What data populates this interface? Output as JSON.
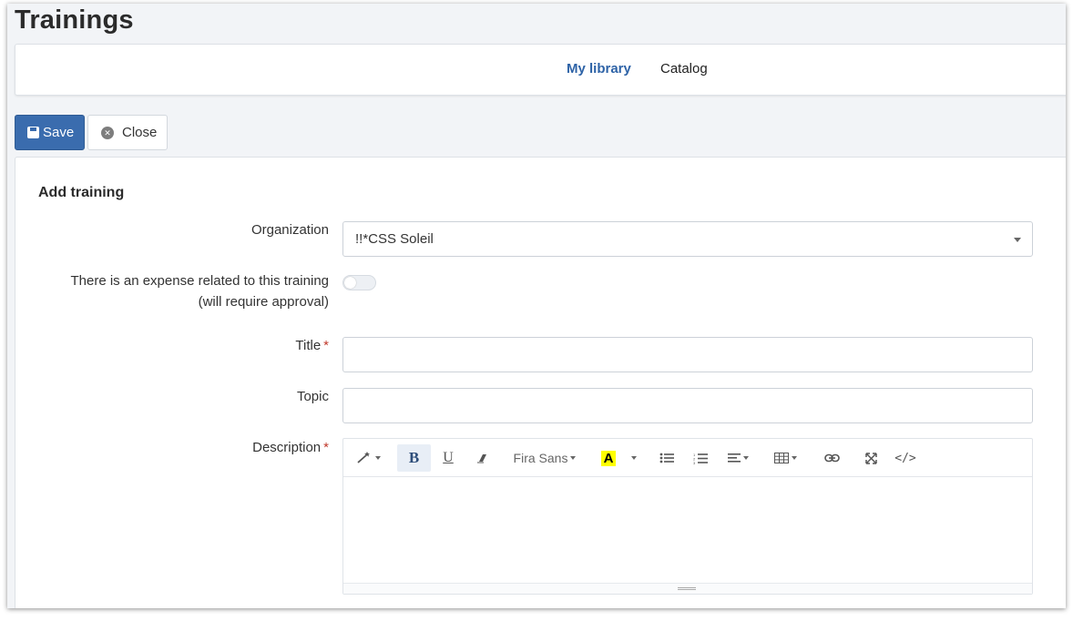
{
  "page": {
    "title": "Trainings"
  },
  "tabs": [
    {
      "label": "My library",
      "active": true
    },
    {
      "label": "Catalog",
      "active": false
    }
  ],
  "toolbar": {
    "save_label": "Save",
    "close_label": "Close"
  },
  "form": {
    "section_title": "Add training",
    "organization": {
      "label": "Organization",
      "value": "!!*CSS Soleil"
    },
    "expense": {
      "label_line1": "There is an expense related to this training",
      "label_line2": "(will require approval)",
      "checked": false
    },
    "title": {
      "label": "Title",
      "required_mark": "*",
      "value": ""
    },
    "topic": {
      "label": "Topic",
      "value": ""
    },
    "description": {
      "label": "Description",
      "required_mark": "*"
    }
  },
  "editor": {
    "font_name": "Fira Sans",
    "bold_glyph": "B",
    "underline_glyph": "U",
    "highlight_glyph": "A",
    "code_glyph": "</>",
    "icons": [
      "magic-icon",
      "bold-icon",
      "underline-icon",
      "eraser-icon",
      "font-family-icon",
      "highlight-color-icon",
      "color-caret-icon",
      "bullet-list-icon",
      "numbered-list-icon",
      "align-icon",
      "table-icon",
      "link-icon",
      "fullscreen-icon",
      "code-view-icon"
    ]
  },
  "colors": {
    "primary": "#3a6cae",
    "active_tab": "#2e63a7",
    "required": "#c0392b",
    "highlight": "#ffff00"
  }
}
